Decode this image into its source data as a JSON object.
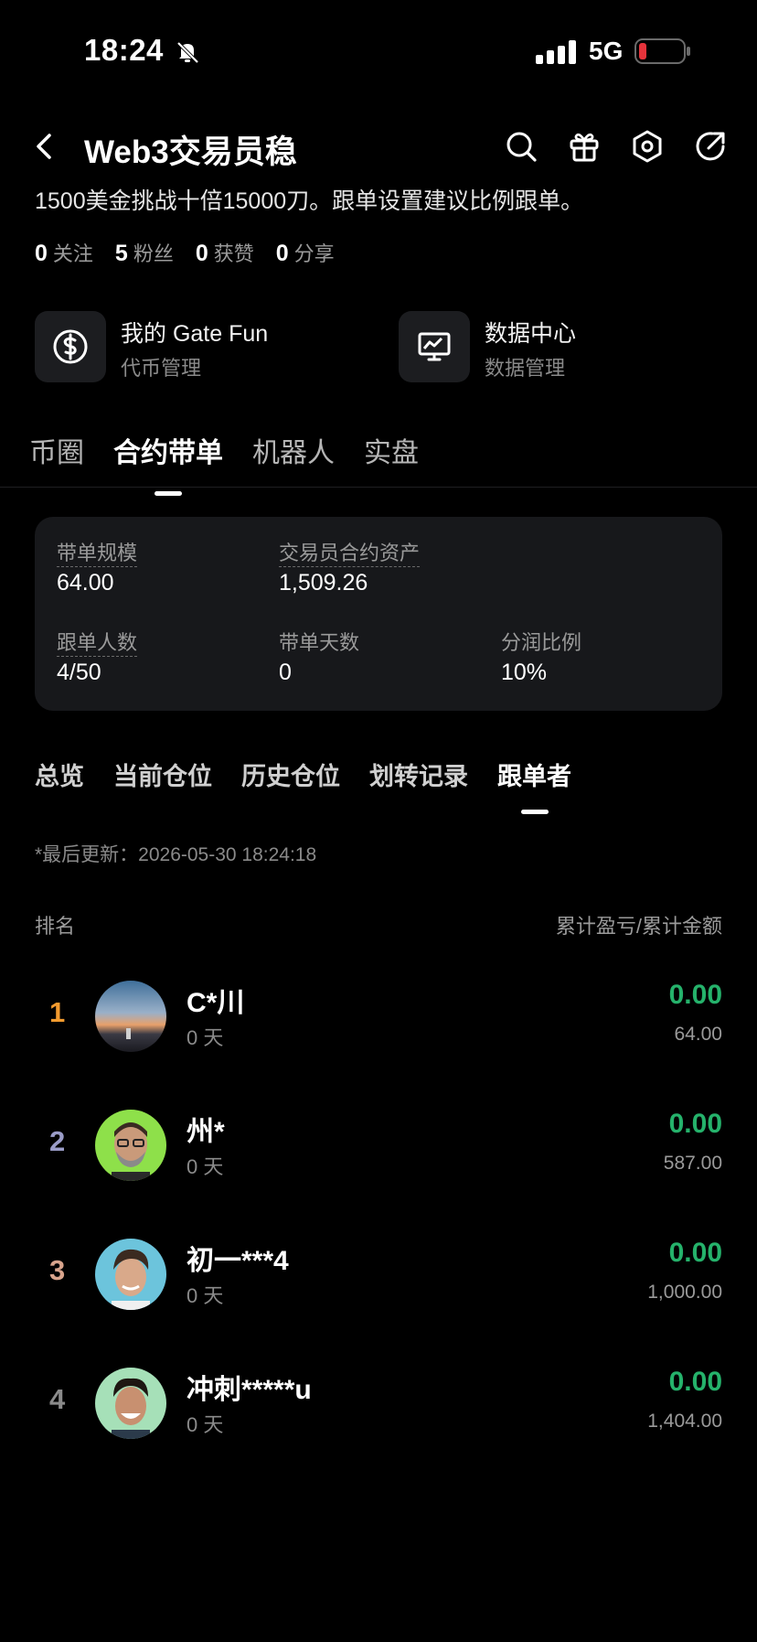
{
  "status": {
    "time": "18:24",
    "network": "5G"
  },
  "header": {
    "title": "Web3交易员稳"
  },
  "bio": "1500美金挑战十倍15000刀。跟单设置建议比例跟单。",
  "stats": [
    {
      "num": "0",
      "label": "关注"
    },
    {
      "num": "5",
      "label": "粉丝"
    },
    {
      "num": "0",
      "label": "获赞"
    },
    {
      "num": "0",
      "label": "分享"
    }
  ],
  "quick": [
    {
      "title": "我的 Gate Fun",
      "sub": "代币管理",
      "icon": "dollar-coin-icon"
    },
    {
      "title": "数据中心",
      "sub": "数据管理",
      "icon": "chart-monitor-icon"
    }
  ],
  "main_tabs": [
    "币圈",
    "合约带单",
    "机器人",
    "实盘"
  ],
  "main_tab_active": 1,
  "info": {
    "scale_label": "带单规模",
    "scale_value": "64.00",
    "assets_label": "交易员合约资产",
    "assets_value": "1,509.26",
    "followers_label": "跟单人数",
    "followers_value": "4/50",
    "days_label": "带单天数",
    "days_value": "0",
    "share_label": "分润比例",
    "share_value": "10%"
  },
  "sub_tabs": [
    "总览",
    "当前仓位",
    "历史仓位",
    "划转记录",
    "跟单者"
  ],
  "sub_tab_active": 4,
  "updated": "*最后更新：2026-05-30 18:24:18",
  "list_head": {
    "left": "排名",
    "right": "累计盈亏/累计金额"
  },
  "followers": [
    {
      "rank": "1",
      "name": "C*川",
      "days": "0 天",
      "pnl": "0.00",
      "amount": "64.00"
    },
    {
      "rank": "2",
      "name": "州*",
      "days": "0 天",
      "pnl": "0.00",
      "amount": "587.00"
    },
    {
      "rank": "3",
      "name": "初一***4",
      "days": "0 天",
      "pnl": "0.00",
      "amount": "1,000.00"
    },
    {
      "rank": "4",
      "name": "冲刺*****u",
      "days": "0 天",
      "pnl": "0.00",
      "amount": "1,404.00"
    }
  ],
  "colors": {
    "positive": "#25b26b",
    "rank1": "#f39b2f",
    "rank2": "#9a9cc7",
    "rank3": "#d8a48c",
    "rank4": "#8a8a8a",
    "battery_low": "#e5333b"
  }
}
